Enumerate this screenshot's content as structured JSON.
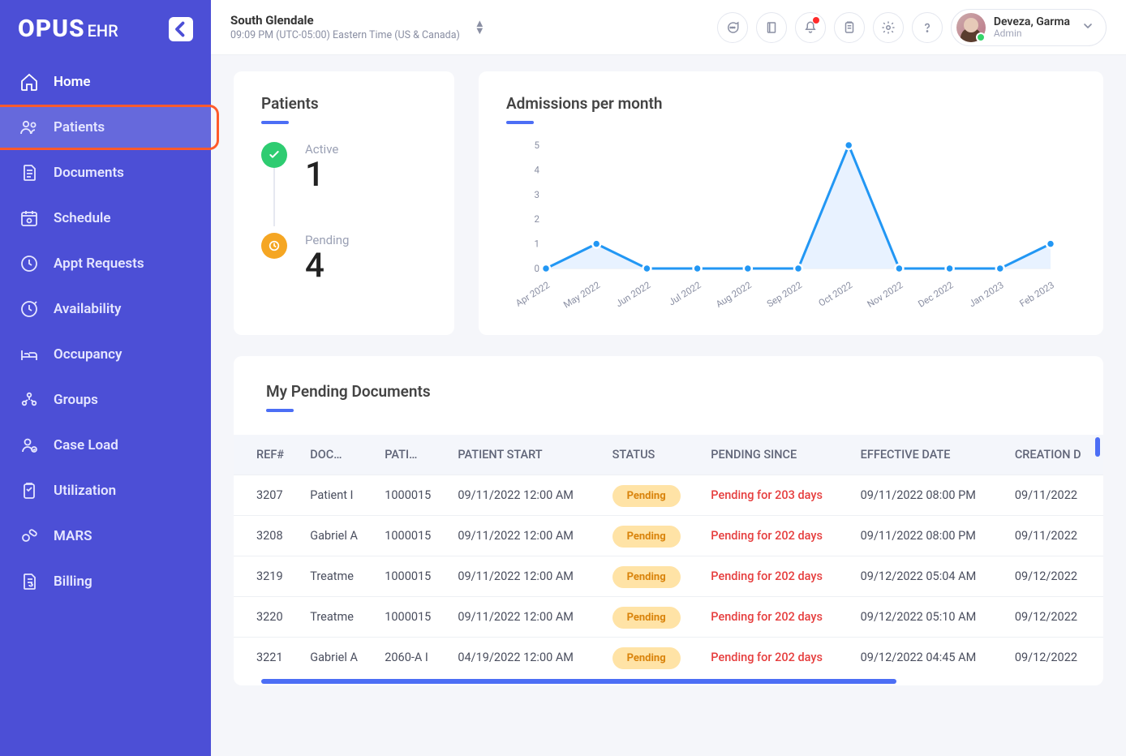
{
  "brand": {
    "main": "OPUS",
    "sub": "EHR"
  },
  "sidebar": {
    "items": [
      {
        "label": "Home"
      },
      {
        "label": "Patients"
      },
      {
        "label": "Documents"
      },
      {
        "label": "Schedule"
      },
      {
        "label": "Appt Requests"
      },
      {
        "label": "Availability"
      },
      {
        "label": "Occupancy"
      },
      {
        "label": "Groups"
      },
      {
        "label": "Case Load"
      },
      {
        "label": "Utilization"
      },
      {
        "label": "MARS"
      },
      {
        "label": "Billing"
      }
    ]
  },
  "header": {
    "location_name": "South Glendale",
    "location_time": "09:09 PM (UTC-05:00) Eastern Time (US & Canada)",
    "user_name": "Deveza, Garma",
    "user_role": "Admin"
  },
  "patients_card": {
    "title": "Patients",
    "active_label": "Active",
    "active_value": "1",
    "pending_label": "Pending",
    "pending_value": "4"
  },
  "chart_card": {
    "title": "Admissions per month"
  },
  "chart_data": {
    "type": "line",
    "categories": [
      "Apr 2022",
      "May 2022",
      "Jun 2022",
      "Jul 2022",
      "Aug 2022",
      "Sep 2022",
      "Oct 2022",
      "Nov 2022",
      "Dec 2022",
      "Jan 2023",
      "Feb 2023"
    ],
    "values": [
      0,
      1,
      0,
      0,
      0,
      0,
      5,
      0,
      0,
      0,
      1
    ],
    "ylim": [
      0,
      5
    ],
    "yticks": [
      0,
      1,
      2,
      3,
      4,
      5
    ],
    "title": "Admissions per month"
  },
  "docs_card": {
    "title": "My Pending Documents",
    "columns": [
      "REF#",
      "DOC…",
      "PATI…",
      "PATIENT START",
      "STATUS",
      "PENDING SINCE",
      "EFFECTIVE DATE",
      "CREATION D"
    ],
    "rows": [
      {
        "ref": "3207",
        "doc": "Patient I",
        "pati": "1000015",
        "start": "09/11/2022 12:00 AM",
        "status": "Pending",
        "pending": "Pending for 203 days",
        "eff": "09/11/2022 08:00 PM",
        "creation": "09/11/2022"
      },
      {
        "ref": "3208",
        "doc": "Gabriel A",
        "pati": "1000015",
        "start": "09/11/2022 12:00 AM",
        "status": "Pending",
        "pending": "Pending for 202 days",
        "eff": "09/11/2022 08:00 PM",
        "creation": "09/11/2022"
      },
      {
        "ref": "3219",
        "doc": "Treatme",
        "pati": "1000015",
        "start": "09/11/2022 12:00 AM",
        "status": "Pending",
        "pending": "Pending for 202 days",
        "eff": "09/12/2022 05:04 AM",
        "creation": "09/12/2022"
      },
      {
        "ref": "3220",
        "doc": "Treatme",
        "pati": "1000015",
        "start": "09/11/2022 12:00 AM",
        "status": "Pending",
        "pending": "Pending for 202 days",
        "eff": "09/12/2022 05:10 AM",
        "creation": "09/12/2022"
      },
      {
        "ref": "3221",
        "doc": "Gabriel A",
        "pati": "2060-A I",
        "start": "04/19/2022 12:00 AM",
        "status": "Pending",
        "pending": "Pending for 202 days",
        "eff": "09/12/2022 04:45 AM",
        "creation": "09/12/2022"
      }
    ]
  }
}
